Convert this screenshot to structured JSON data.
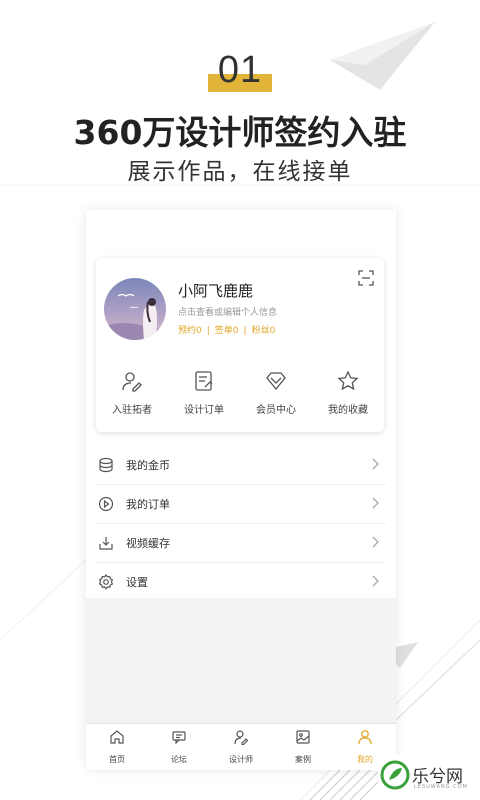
{
  "promo": {
    "number": "01",
    "title": "360万设计师签约入驻",
    "subtitle": "展示作品，在线接单"
  },
  "profile": {
    "name": "小阿飞鹿鹿",
    "hint": "点击查看或编辑个人信息",
    "stats": [
      "预约0",
      "签单0",
      "粉丝0"
    ]
  },
  "quick_actions": [
    {
      "label": "入驻拓者",
      "icon": "user-edit-icon"
    },
    {
      "label": "设计订单",
      "icon": "document-edit-icon"
    },
    {
      "label": "会员中心",
      "icon": "diamond-icon"
    },
    {
      "label": "我的收藏",
      "icon": "star-icon"
    }
  ],
  "menu": [
    {
      "label": "我的金币",
      "icon": "coins-icon"
    },
    {
      "label": "我的订单",
      "icon": "play-circle-icon"
    },
    {
      "label": "视频缓存",
      "icon": "download-icon"
    },
    {
      "label": "设置",
      "icon": "gear-icon"
    }
  ],
  "tabbar": {
    "active_index": 4,
    "items": [
      {
        "label": "首页",
        "icon": "home-icon"
      },
      {
        "label": "论坛",
        "icon": "chat-icon"
      },
      {
        "label": "设计师",
        "icon": "designer-icon"
      },
      {
        "label": "案例",
        "icon": "gallery-icon"
      },
      {
        "label": "我的",
        "icon": "person-icon"
      }
    ]
  },
  "watermark": {
    "text": "乐兮网",
    "url": "LESUWANG.COM"
  },
  "colors": {
    "accent": "#e2b43a",
    "stat_text": "#e2a82a",
    "background": "#f3f3f3"
  }
}
